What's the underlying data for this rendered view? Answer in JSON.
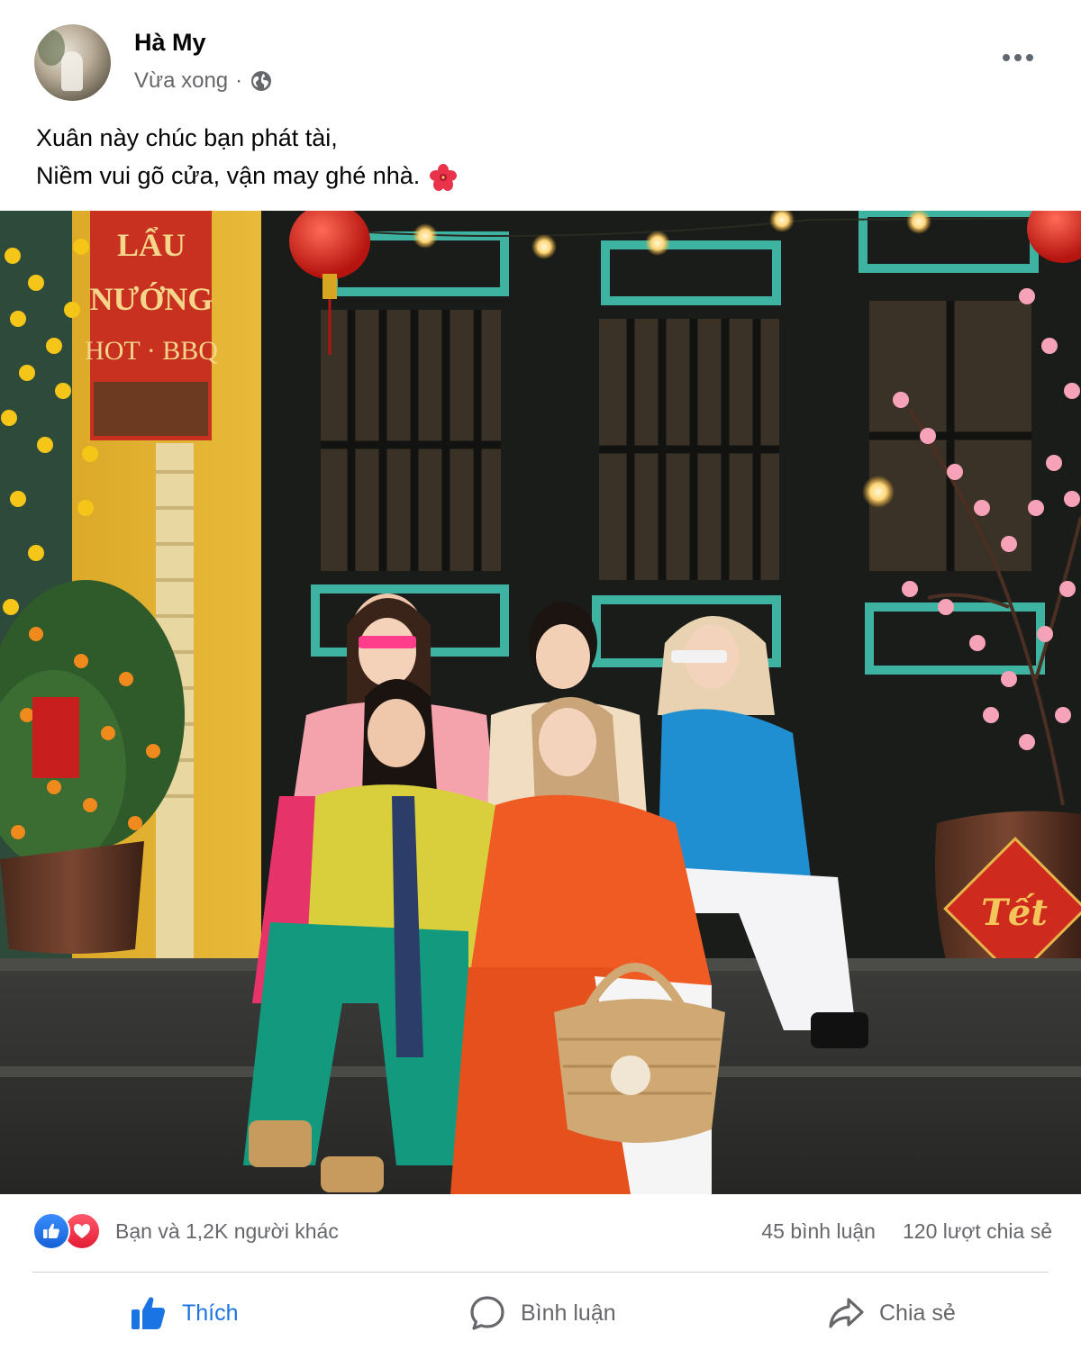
{
  "post": {
    "author": "Hà My",
    "timestamp": "Vừa xong",
    "separator": "·",
    "audience_icon": "globe-icon",
    "menu_icon": "more-options-icon",
    "caption_lines": [
      "Xuân này chúc bạn phát tài,",
      "Niềm vui gõ cửa, vận may ghé nhà."
    ],
    "caption_emoji": "hibiscus-flower-icon"
  },
  "photo": {
    "banner_lines": [
      "LẨU",
      "NƯỚNG",
      "HOT · BBQ"
    ],
    "pot_label": "Tết",
    "description_icon": "group-photo"
  },
  "stats": {
    "reactions_label": "Bạn và 1,2K người khác",
    "comments_label": "45 bình luận",
    "shares_label": "120 lượt chia sẻ",
    "reaction_icons": [
      "like-icon",
      "love-icon"
    ]
  },
  "actions": {
    "like_label": "Thích",
    "comment_label": "Bình luận",
    "share_label": "Chia sẻ"
  },
  "colors": {
    "accent": "#1b74e4",
    "secondary_text": "#65676b",
    "like_react": "#2d7cf0",
    "love_react": "#f02849"
  }
}
